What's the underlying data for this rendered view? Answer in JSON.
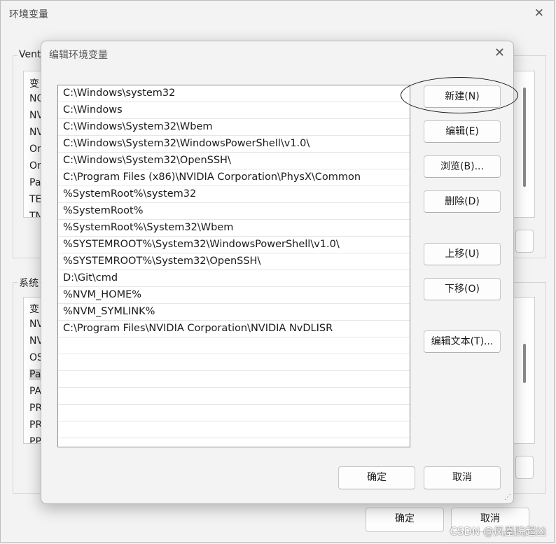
{
  "background_window": {
    "title": "环境变量",
    "close_symbol": "✕",
    "user_group_label": "Vent",
    "user_list_items": [
      "变",
      "NO",
      "NV",
      "NV",
      "On",
      "On",
      "Pa",
      "TE",
      "TN"
    ],
    "system_group_label": "系统",
    "system_list_items": [
      "变",
      "NV",
      "NV",
      "OS",
      "Pa",
      "PA",
      "PR",
      "PR",
      "PP"
    ],
    "ok_label": "确定",
    "cancel_label": "取消"
  },
  "dialog": {
    "title": "编辑环境变量",
    "close_symbol": "✕",
    "paths": [
      "C:\\Windows\\system32",
      "C:\\Windows",
      "C:\\Windows\\System32\\Wbem",
      "C:\\Windows\\System32\\WindowsPowerShell\\v1.0\\",
      "C:\\Windows\\System32\\OpenSSH\\",
      "C:\\Program Files (x86)\\NVIDIA Corporation\\PhysX\\Common",
      "%SystemRoot%\\system32",
      "%SystemRoot%",
      "%SystemRoot%\\System32\\Wbem",
      "%SYSTEMROOT%\\System32\\WindowsPowerShell\\v1.0\\",
      "%SYSTEMROOT%\\System32\\OpenSSH\\",
      "D:\\Git\\cmd",
      "%NVM_HOME%",
      "%NVM_SYMLINK%",
      "C:\\Program Files\\NVIDIA Corporation\\NVIDIA NvDLISR",
      "",
      "",
      "",
      "",
      "",
      "",
      ""
    ],
    "buttons": {
      "new": "新建(N)",
      "edit": "编辑(E)",
      "browse": "浏览(B)...",
      "delete": "删除(D)",
      "move_up": "上移(U)",
      "move_down": "下移(O)",
      "edit_text": "编辑文本(T)...",
      "ok": "确定",
      "cancel": "取消"
    }
  },
  "watermark": "CSDN @凤凰院超凶"
}
